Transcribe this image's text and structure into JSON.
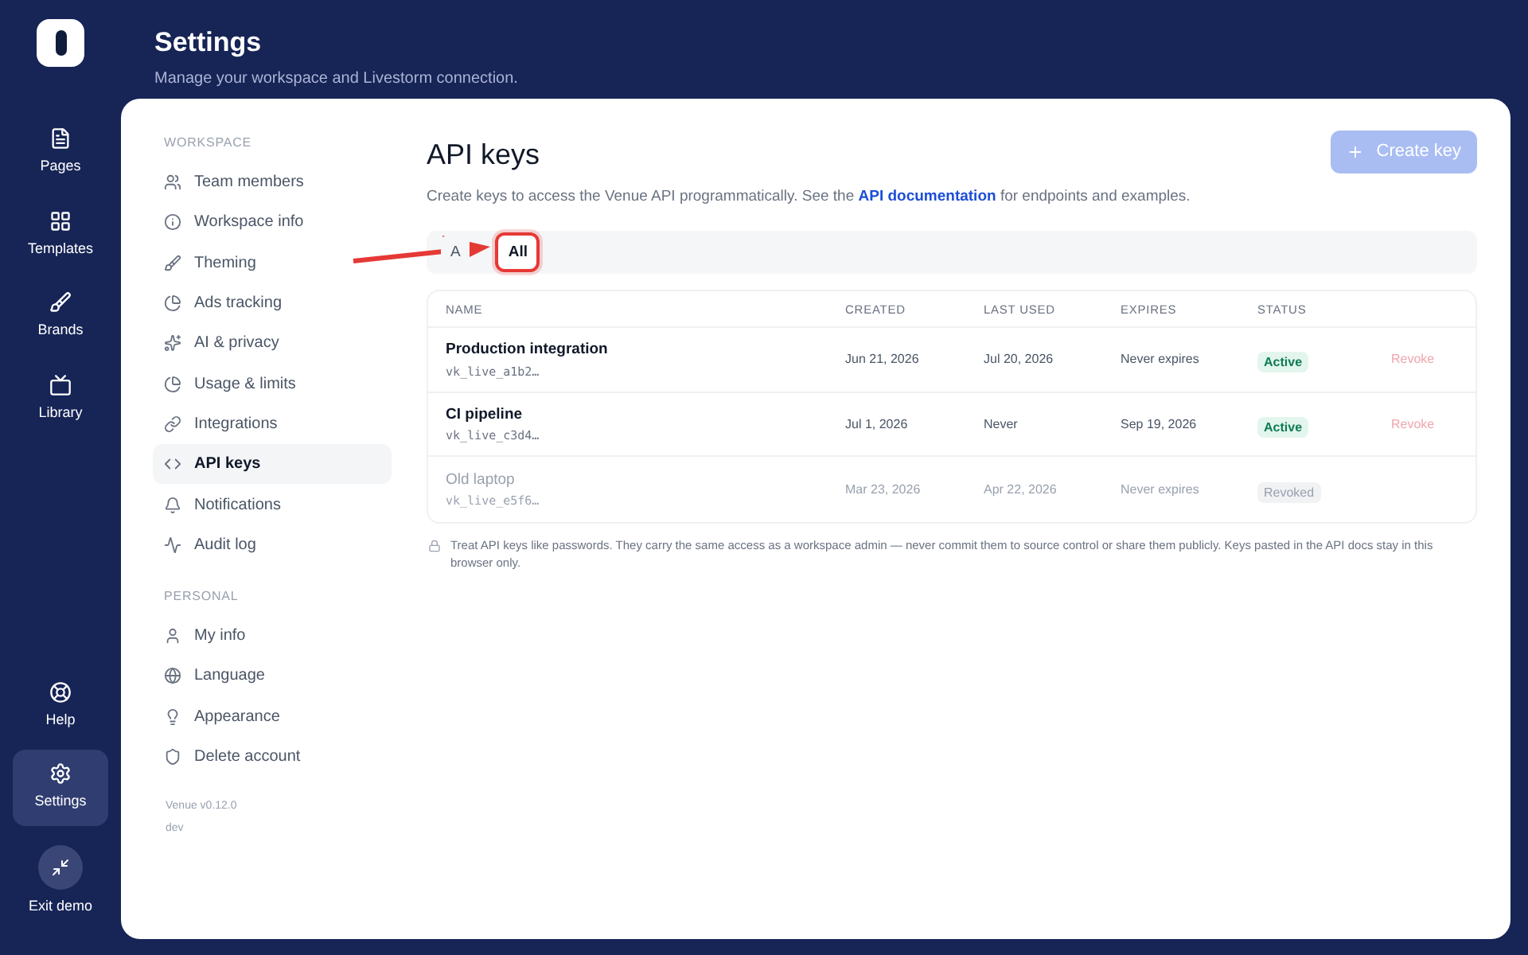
{
  "rail": {
    "items": [
      {
        "label": "Pages",
        "kind": "pages",
        "selected": false
      },
      {
        "label": "Templates",
        "kind": "grid",
        "selected": false
      },
      {
        "label": "Brands",
        "kind": "brush",
        "selected": false
      },
      {
        "label": "Library",
        "kind": "tv",
        "selected": false
      }
    ],
    "bottom": [
      {
        "label": "Help",
        "kind": "help",
        "selected": false
      },
      {
        "label": "Settings",
        "kind": "gear",
        "selected": true
      },
      {
        "label": "Exit demo",
        "kind": "exit",
        "selected": false
      }
    ]
  },
  "header": {
    "title": "Settings",
    "subtitle": "Manage your workspace and Livestorm connection."
  },
  "nav": {
    "sections": [
      {
        "heading": "WORKSPACE",
        "items": [
          {
            "label": "Team members",
            "kind": "users",
            "selected": false
          },
          {
            "label": "Workspace info",
            "kind": "info",
            "selected": false
          },
          {
            "label": "Theming",
            "kind": "brush",
            "selected": false
          },
          {
            "label": "Ads tracking",
            "kind": "chart",
            "selected": false
          },
          {
            "label": "AI & privacy",
            "kind": "sparkle",
            "selected": false
          },
          {
            "label": "Usage & limits",
            "kind": "chart",
            "selected": false
          },
          {
            "label": "Integrations",
            "kind": "link",
            "selected": false
          },
          {
            "label": "API keys",
            "kind": "code",
            "selected": true
          },
          {
            "label": "Notifications",
            "kind": "bell",
            "selected": false
          },
          {
            "label": "Audit log",
            "kind": "pulse",
            "selected": false
          }
        ]
      },
      {
        "heading": "PERSONAL",
        "items": [
          {
            "label": "My info",
            "kind": "user",
            "selected": false
          },
          {
            "label": "Language",
            "kind": "globe",
            "selected": false
          },
          {
            "label": "Appearance",
            "kind": "bulb",
            "selected": false
          },
          {
            "label": "Delete account",
            "kind": "shield",
            "selected": false
          }
        ]
      }
    ],
    "version": "Venue v0.12.0",
    "env": "dev"
  },
  "main": {
    "title": "API keys",
    "description": "Create keys to access the Venue API programmatically. See the **API documentation** for endpoints and examples.",
    "create_button": "Create key",
    "tabs": [
      {
        "label": "A",
        "selected": false
      },
      {
        "label": "All",
        "selected": true
      }
    ],
    "table": {
      "columns": [
        "NAME",
        "CREATED",
        "LAST USED",
        "EXPIRES",
        "STATUS"
      ],
      "rows": [
        {
          "name": "Production integration",
          "key": "vk_live_a1b2…",
          "created": "Jun 21, 2026",
          "last_used": "Jul 20, 2026",
          "expires": "Never expires",
          "status": "Active",
          "revoked": false,
          "action": "Revoke"
        },
        {
          "name": "CI pipeline",
          "key": "vk_live_c3d4…",
          "created": "Jul 1, 2026",
          "last_used": "Never",
          "expires": "Sep 19, 2026",
          "status": "Active",
          "revoked": false,
          "action": "Revoke"
        },
        {
          "name": "Old laptop",
          "key": "vk_live_e5f6…",
          "created": "Mar 23, 2026",
          "last_used": "Apr 22, 2026",
          "expires": "Never expires",
          "status": "Revoked",
          "revoked": true
        }
      ]
    },
    "note": "Treat API keys like passwords. They carry the same access as a workspace admin — never commit them to source control or share them publicly. Keys pasted in the API docs stay in this browser only."
  }
}
